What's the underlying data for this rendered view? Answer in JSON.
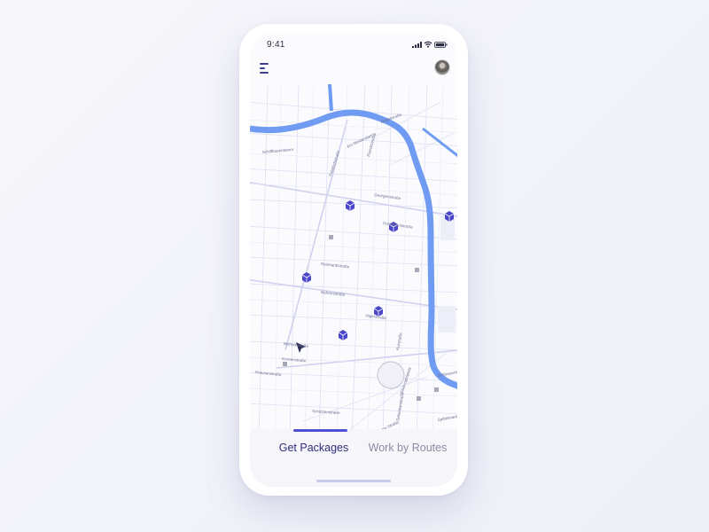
{
  "status_bar": {
    "time": "9:41"
  },
  "header": {
    "menu_icon": "menu-icon",
    "avatar_icon": "avatar"
  },
  "map": {
    "river_color": "#6f9cf2",
    "marker_color": "#4a46c8",
    "street_labels": [
      "Ziegelstraße",
      "Schiffbauerdamm",
      "Am Weidendamm",
      "Friedrichstraße",
      "Planckstraße",
      "Georgenstraße",
      "Dorotheenstraße",
      "Reinhardtstraße",
      "Behrenstraße",
      "Jägerstraße",
      "Mohrenstraße",
      "Kronenstraße",
      "Krausenstraße",
      "Schützenstraße",
      "Zimmerstraße",
      "Rudi-Dutschke-Straße",
      "Axel-Springer-Straße",
      "Kurstraße",
      "Sebastianstraße",
      "Schleusenbrücke",
      "Hausvogteiplatz",
      "Spittelmarkt"
    ]
  },
  "tabs": {
    "active_label": "Get Packages",
    "inactive_label": "Work by Routes",
    "accent_color": "#4f4fd4"
  }
}
